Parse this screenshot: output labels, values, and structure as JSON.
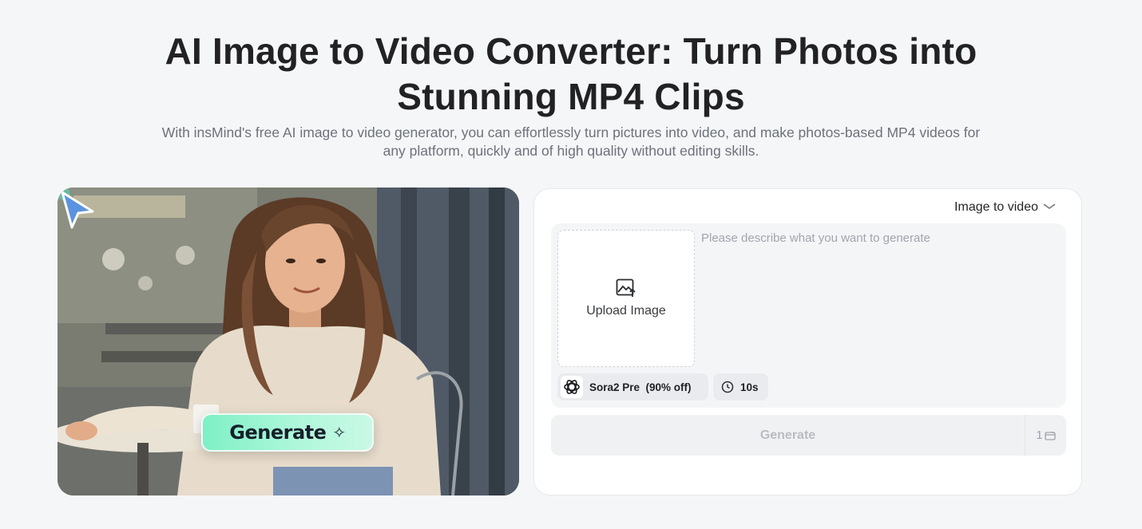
{
  "hero": {
    "title_line1": "AI Image to Video Converter: Turn Photos into",
    "title_line2": "Stunning MP4 Clips",
    "subtitle": "With insMind's free AI image to video generator, you can effortlessly turn pictures into video, and make photos-based MP4 videos for any platform, quickly and of high quality without editing skills."
  },
  "preview": {
    "badge_label": "Generate",
    "badge_icon": "sparkle-icon",
    "cursor_icon": "cursor-pointer-icon"
  },
  "generator": {
    "mode_label": "Image to video",
    "mode_icon": "chevron-down-icon",
    "upload_label": "Upload Image",
    "upload_icon": "image-upload-icon",
    "prompt_placeholder": "Please describe what you want to generate",
    "model_label": "Sora2 Pre  (90% off)",
    "model_icon": "openai-logo-icon",
    "duration_label": "10s",
    "duration_icon": "clock-icon",
    "generate_label": "Generate",
    "credit_count": "1",
    "credit_icon": "credit-icon"
  },
  "colors": {
    "background": "#f5f6f8",
    "badge_gradient_start": "#7ef0c6",
    "cursor_blue": "#4a90e2",
    "disabled_text": "#b9bcc2"
  }
}
